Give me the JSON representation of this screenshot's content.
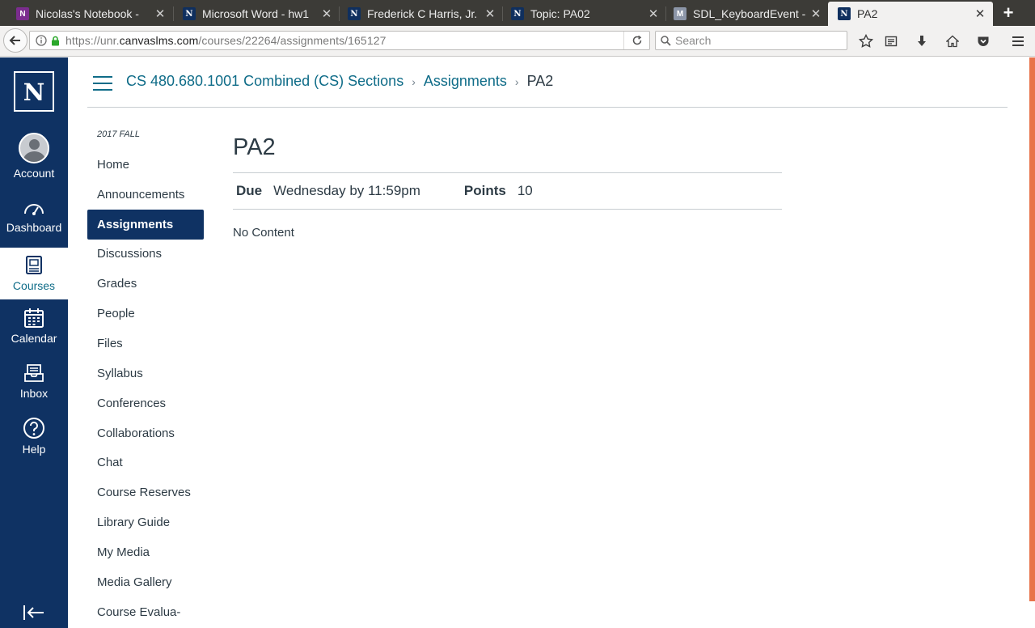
{
  "browser": {
    "tabs": [
      {
        "title": "Nicolas's Notebook - ",
        "icon": "onenote-icon"
      },
      {
        "title": "Microsoft Word - hw1",
        "icon": "canvas-n-icon"
      },
      {
        "title": "Frederick C Harris, Jr.",
        "icon": "canvas-n-icon"
      },
      {
        "title": "Topic: PA02",
        "icon": "canvas-n-icon"
      },
      {
        "title": "SDL_KeyboardEvent - ",
        "icon": "moodle-icon"
      },
      {
        "title": "PA2",
        "icon": "canvas-n-icon"
      }
    ],
    "url_prefix": "https://unr.",
    "url_domain": "canvaslms.com",
    "url_path": "/courses/22264/assignments/165127",
    "search_placeholder": "Search"
  },
  "global_nav": {
    "logo": "N",
    "items": [
      {
        "label": "Account",
        "icon": "account-avatar-icon"
      },
      {
        "label": "Dashboard",
        "icon": "dashboard-icon"
      },
      {
        "label": "Courses",
        "icon": "courses-icon",
        "active": true
      },
      {
        "label": "Calendar",
        "icon": "calendar-icon"
      },
      {
        "label": "Inbox",
        "icon": "inbox-icon"
      },
      {
        "label": "Help",
        "icon": "help-icon"
      }
    ]
  },
  "breadcrumb": {
    "course": "CS 480.680.1001 Combined (CS) Sections",
    "section": "Assignments",
    "current": "PA2"
  },
  "course_nav": {
    "term": "2017 FALL",
    "items": [
      "Home",
      "Announcements",
      "Assignments",
      "Discussions",
      "Grades",
      "People",
      "Files",
      "Syllabus",
      "Conferences",
      "Collaborations",
      "Chat",
      "Course Reserves",
      "Library Guide",
      "My Media",
      "Media Gallery",
      "Course Evalua-"
    ],
    "active_item": "Assignments"
  },
  "assignment": {
    "title": "PA2",
    "due_label": "Due",
    "due_value": "Wednesday by 11:59pm",
    "points_label": "Points",
    "points_value": "10",
    "body": "No Content"
  },
  "colors": {
    "nav_bg": "#0f3263",
    "link": "#0f6c88",
    "text": "#2d3b45"
  }
}
